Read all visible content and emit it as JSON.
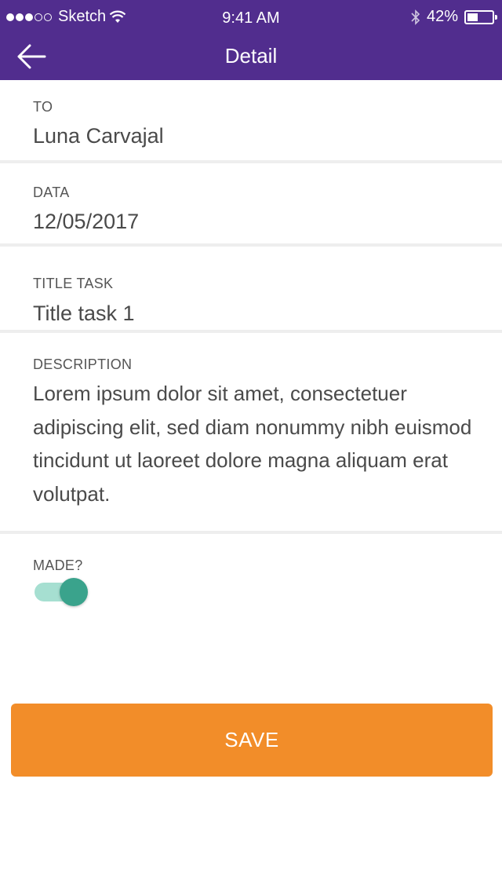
{
  "status_bar": {
    "carrier": "Sketch",
    "time": "9:41 AM",
    "battery_percent": "42%",
    "battery_level": 0.42,
    "signal_icon": "signal-dots-icon",
    "wifi_icon": "wifi-icon",
    "bluetooth_icon": "bluetooth-icon"
  },
  "header": {
    "title": "Detail",
    "back_icon": "arrow-left-icon",
    "color": "#512d8e"
  },
  "fields": {
    "to": {
      "label": "TO",
      "value": "Luna Carvajal"
    },
    "data": {
      "label": "DATA",
      "value": "12/05/2017"
    },
    "title_task": {
      "label": "TITLE TASK",
      "value": "Title task 1"
    },
    "description": {
      "label": "DESCRIPTION",
      "value": "Lorem ipsum dolor sit amet, consectetuer adipiscing elit, sed diam nonummy nibh euismod tincidunt ut laoreet dolore magna aliquam erat volutpat."
    },
    "made": {
      "label": "MADE?",
      "checked": true
    }
  },
  "actions": {
    "save_label": "SAVE",
    "save_color": "#f28d29",
    "toggle_color": "#3aa38c"
  }
}
